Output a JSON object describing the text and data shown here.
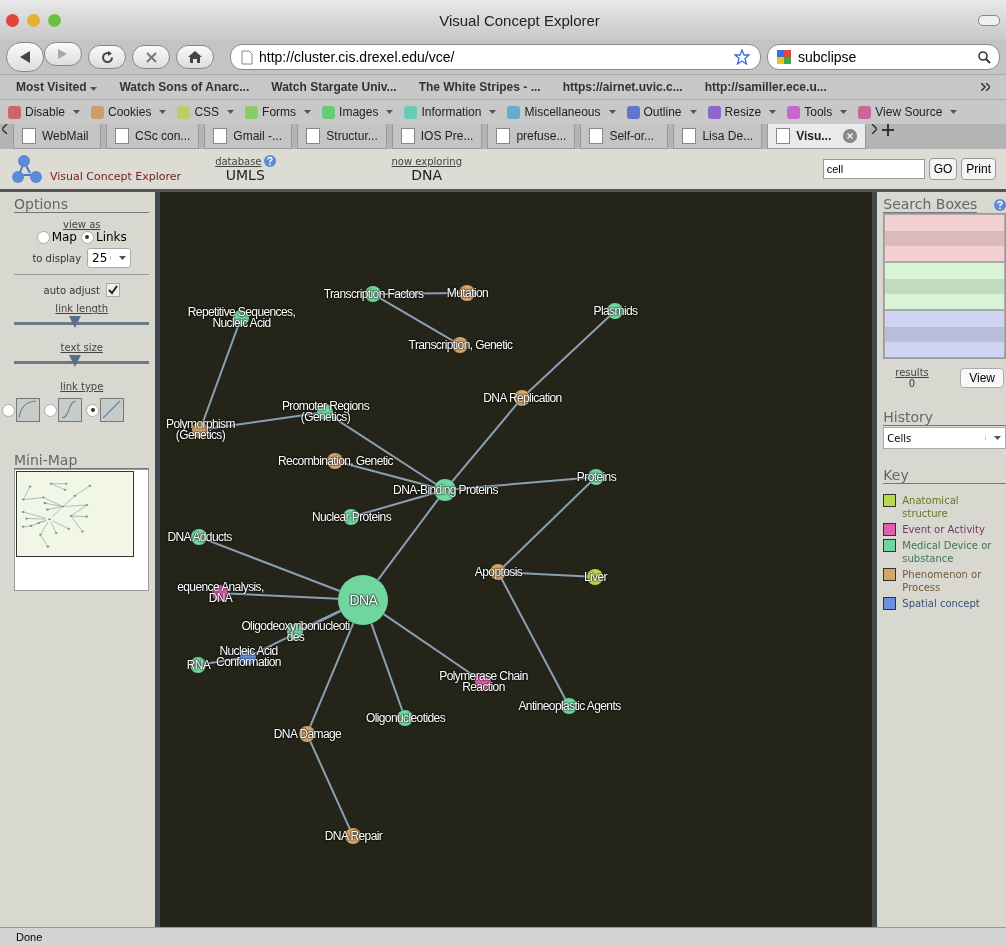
{
  "window": {
    "title": "Visual Concept Explorer"
  },
  "toolbar": {
    "url": "http://cluster.cis.drexel.edu/vce/",
    "search": "subclipse"
  },
  "bookmarks": [
    {
      "label": "Most Visited",
      "kind": "menu"
    },
    {
      "label": "Watch Sons of Anarc...",
      "kind": "link"
    },
    {
      "label": "Watch Stargate Univ...",
      "kind": "link"
    },
    {
      "label": "The White Stripes - ...",
      "kind": "link"
    },
    {
      "label": "https://airnet.uvic.c...",
      "kind": "link"
    },
    {
      "label": "http://samiller.ece.u...",
      "kind": "link"
    }
  ],
  "dev_toolbar": [
    "Disable",
    "Cookies",
    "CSS",
    "Forms",
    "Images",
    "Information",
    "Miscellaneous",
    "Outline",
    "Resize",
    "Tools",
    "View Source"
  ],
  "tabs": [
    {
      "label": "WebMail",
      "selected": false
    },
    {
      "label": "CSc con...",
      "selected": false
    },
    {
      "label": "Gmail -...",
      "selected": false
    },
    {
      "label": "Structur...",
      "selected": false
    },
    {
      "label": "IOS Pre...",
      "selected": false
    },
    {
      "label": "prefuse...",
      "selected": false
    },
    {
      "label": "Self-or...",
      "selected": false
    },
    {
      "label": "Lisa De...",
      "selected": false
    },
    {
      "label": "Visu...",
      "selected": true
    }
  ],
  "header": {
    "logo_text": "Visual Concept Explorer",
    "database_label": "database",
    "database": "UMLS",
    "exploring_label": "now exploring",
    "exploring": "DNA",
    "search": "cell",
    "go": "GO",
    "print": "Print"
  },
  "options": {
    "title": "Options",
    "view_as_label": "view as",
    "view_modes": [
      {
        "label": "Map",
        "selected": false
      },
      {
        "label": "Links",
        "selected": true
      }
    ],
    "display_label": "to display",
    "display_value": "25",
    "auto_adjust_label": "auto adjust",
    "auto_adjust": true,
    "link_length_label": "link length",
    "link_length": {
      "level": 0.45
    },
    "text_size_label": "text size",
    "text_size": {
      "level": 0.45
    },
    "link_type_label": "link type",
    "link_types": [
      {
        "kind": "curve",
        "selected": false
      },
      {
        "kind": "s-curve",
        "selected": false
      },
      {
        "kind": "straight",
        "selected": true
      }
    ],
    "minimap_title": "Mini-Map"
  },
  "graph": {
    "nodes": [
      {
        "label": "DNA",
        "color": "#6fd6a0",
        "kind": "focus"
      },
      {
        "label": "DNA-Binding Proteins",
        "color": "#6fd6a0",
        "kind": "concept"
      },
      {
        "label": "Transcription Factors",
        "color": "#6fd6a0",
        "kind": "concept"
      },
      {
        "label": "Mutation",
        "color": "#d4a46a",
        "kind": "concept"
      },
      {
        "label": "Transcription, Genetic",
        "color": "#d4a46a",
        "kind": "concept"
      },
      {
        "label": "Plasmids",
        "color": "#6fd6a0",
        "kind": "concept"
      },
      {
        "label": "DNA Replication",
        "color": "#d4a46a",
        "kind": "concept"
      },
      {
        "label": "Repetitive Sequences,\nNucleic Acid",
        "color": "#6fd6a0",
        "kind": "concept"
      },
      {
        "label": "Polymorphism\n(Genetics)",
        "color": "#d4a46a",
        "kind": "concept"
      },
      {
        "label": "Promoter Regions\n(Genetics)",
        "color": "#6fd6a0",
        "kind": "concept"
      },
      {
        "label": "Recombination, Genetic",
        "color": "#d4a46a",
        "kind": "concept"
      },
      {
        "label": "Proteins",
        "color": "#6fd6a0",
        "kind": "concept"
      },
      {
        "label": "Nuclear Proteins",
        "color": "#6fd6a0",
        "kind": "concept"
      },
      {
        "label": "DNA Adducts",
        "color": "#6fd6a0",
        "kind": "concept"
      },
      {
        "label": "Apoptosis",
        "color": "#d4a46a",
        "kind": "concept"
      },
      {
        "label": "Liver",
        "color": "#b8d84a",
        "kind": "concept"
      },
      {
        "label": "equence Analysis,\nDNA",
        "color": "#e060b0",
        "kind": "concept"
      },
      {
        "label": "Oligodeoxyribonucleoti\ndes",
        "color": "#6fd6a0",
        "kind": "concept"
      },
      {
        "label": "RNA",
        "color": "#6fd6a0",
        "kind": "concept"
      },
      {
        "label": "Nucleic Acid\nConformation",
        "color": "#6a90e0",
        "kind": "concept"
      },
      {
        "label": "Polymerase Chain\nReaction",
        "color": "#e060b0",
        "kind": "concept"
      },
      {
        "label": "Antineoplastic Agents",
        "color": "#6fd6a0",
        "kind": "concept"
      },
      {
        "label": "Oligonucleotides",
        "color": "#6fd6a0",
        "kind": "concept"
      },
      {
        "label": "DNA Damage",
        "color": "#d4a46a",
        "kind": "concept"
      },
      {
        "label": "DNA Repair",
        "color": "#d4a46a",
        "kind": "concept"
      }
    ]
  },
  "search_boxes": {
    "title": "Search Boxes",
    "boxes": [
      {
        "color": "#f4d0d0"
      },
      {
        "color": "#d8f4d4"
      },
      {
        "color": "#d0d4f4"
      }
    ],
    "results_label": "results",
    "results": "0",
    "view": "View"
  },
  "history": {
    "title": "History",
    "value": "Cells"
  },
  "key": {
    "title": "Key",
    "items": [
      {
        "label": "Anatomical structure",
        "color": "#b8d84a"
      },
      {
        "label": "Event or Activity",
        "color": "#e060b0"
      },
      {
        "label": "Medical Device or substance",
        "color": "#6fd6a0"
      },
      {
        "label": "Phenomenon or Process",
        "color": "#d4a46a"
      },
      {
        "label": "Spatial concept",
        "color": "#6a90e0"
      }
    ]
  },
  "status_bar": "Done"
}
